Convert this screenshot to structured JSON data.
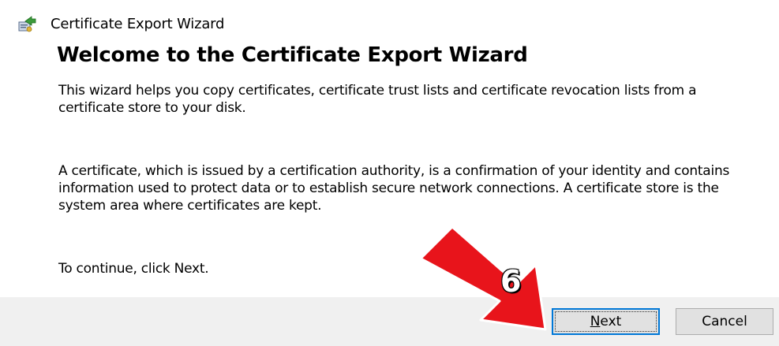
{
  "window": {
    "title": "Certificate Export Wizard"
  },
  "wizard": {
    "heading": "Welcome to the Certificate Export Wizard",
    "paragraph_1": "This wizard helps you copy certificates, certificate trust lists and certificate revocation lists from a certificate store to your disk.",
    "paragraph_2": "A certificate, which is issued by a certification authority, is a confirmation of your identity and contains information used to protect data or to establish secure network connections. A certificate store is the system area where certificates are kept.",
    "paragraph_3": "To continue, click Next."
  },
  "buttons": {
    "next_mnemonic": "N",
    "next_rest": "ext",
    "cancel_label": "Cancel"
  },
  "annotation": {
    "step_number": "6",
    "arrow_color": "#e8141b"
  },
  "icons": {
    "app_icon": "certificate-export-icon"
  }
}
